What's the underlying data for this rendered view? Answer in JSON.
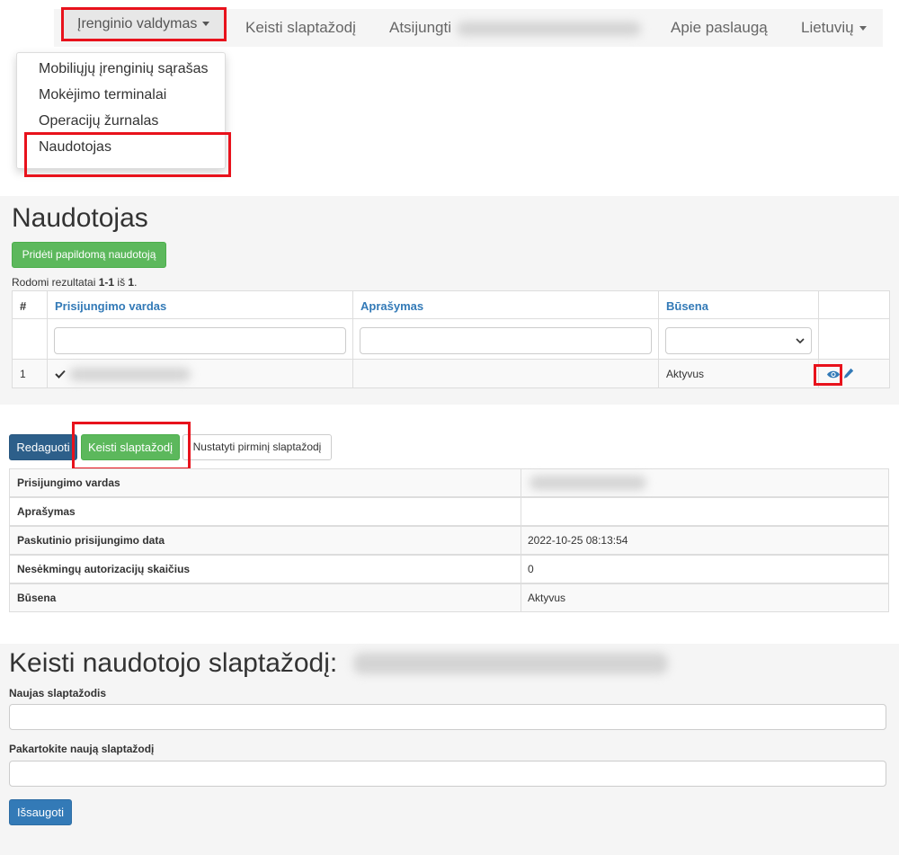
{
  "navbar": {
    "device_management": "Įrenginio valdymas",
    "change_password": "Keisti slaptažodį",
    "logout": "Atsijungti",
    "about": "Apie paslaugą",
    "language": "Lietuvių"
  },
  "dropdown": {
    "items": [
      "Mobiliųjų įrenginių sąrašas",
      "Mokėjimo terminalai",
      "Operacijų žurnalas",
      "Naudotojas"
    ]
  },
  "user_list": {
    "title": "Naudotojas",
    "add_button": "Pridėti papildomą naudotoją",
    "summary_prefix": "Rodomi rezultatai ",
    "summary_range": "1-1",
    "summary_mid": " iš ",
    "summary_total": "1",
    "summary_suffix": ".",
    "columns": [
      "#",
      "Prisijungimo vardas",
      "Aprašymas",
      "Būsena"
    ],
    "rows": [
      {
        "index": "1",
        "status": "Aktyvus"
      }
    ]
  },
  "details": {
    "edit_button": "Redaguoti",
    "change_password_button": "Keisti slaptažodį",
    "reset_password_button": "Nustatyti pirminį slaptažodį",
    "rows": [
      {
        "label": "Prisijungimo vardas",
        "value": ""
      },
      {
        "label": "Aprašymas",
        "value": ""
      },
      {
        "label": "Paskutinio prisijungimo data",
        "value": "2022-10-25 08:13:54"
      },
      {
        "label": "Nesėkmingų autorizacijų skaičius",
        "value": "0"
      },
      {
        "label": "Būsena",
        "value": "Aktyvus"
      }
    ]
  },
  "change_password_form": {
    "title": "Keisti naudotojo slaptažodį:",
    "new_password_label": "Naujas slaptažodis",
    "repeat_password_label": "Pakartokite naują slaptažodį",
    "save_button": "Išsaugoti"
  },
  "colors": {
    "highlight": "#e8121c",
    "success": "#5cb85c",
    "primary": "#337ab7",
    "link": "#337ab7"
  }
}
